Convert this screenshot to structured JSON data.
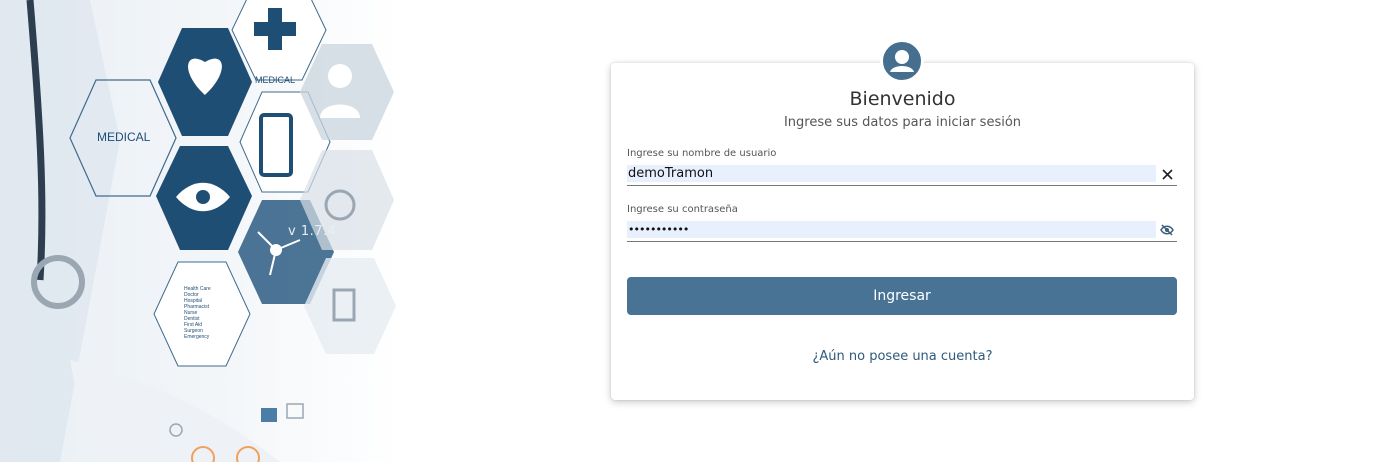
{
  "hero": {
    "hex_labels": [
      "MEDICAL",
      "MEDICAL"
    ],
    "list_items": [
      "Health Care",
      "Doctor",
      "Hospital",
      "Pharmacist",
      "Nurse",
      "Dentist",
      "First Aid",
      "Surgeon",
      "Emergency"
    ],
    "version": "v 1.7.4"
  },
  "login": {
    "avatar_icon": "user-circle-icon",
    "title": "Bienvenido",
    "subtitle": "Ingrese sus datos para iniciar sesión",
    "username": {
      "label": "Ingrese su nombre de usuario",
      "value": "demoTramon",
      "icon": "close-icon"
    },
    "password": {
      "label": "Ingrese su contraseña",
      "value": "•••••••••••",
      "icon": "eye-off-icon"
    },
    "submit_label": "Ingresar",
    "register_link": "¿Aún no posee una cuenta?"
  },
  "colors": {
    "accent": "#487394",
    "hex_dark": "#1f4e74",
    "input_bg": "#e8f0fe"
  }
}
